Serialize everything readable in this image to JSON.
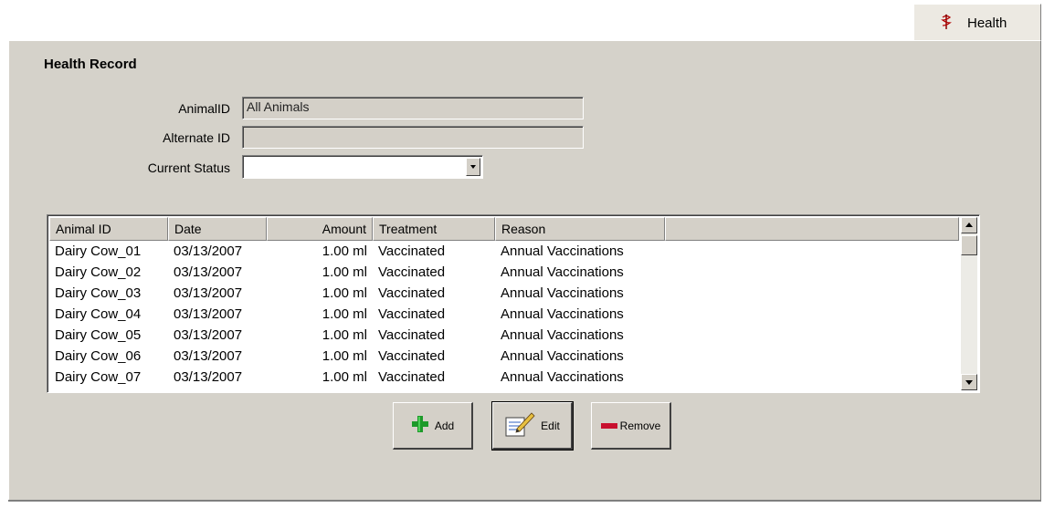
{
  "tab": {
    "label": "Health"
  },
  "section": {
    "title": "Health Record"
  },
  "form": {
    "animal_id_label": "AnimalID",
    "animal_id_value": "All Animals",
    "alternate_id_label": "Alternate ID",
    "alternate_id_value": "",
    "current_status_label": "Current Status",
    "current_status_value": ""
  },
  "grid": {
    "columns": [
      "Animal ID",
      "Date",
      "Amount",
      "Treatment",
      "Reason",
      ""
    ],
    "rows": [
      {
        "animal_id": "Dairy Cow_01",
        "date": "03/13/2007",
        "amount": "1.00 ml",
        "treatment": "Vaccinated",
        "reason": "Annual Vaccinations"
      },
      {
        "animal_id": "Dairy Cow_02",
        "date": "03/13/2007",
        "amount": "1.00 ml",
        "treatment": "Vaccinated",
        "reason": "Annual Vaccinations"
      },
      {
        "animal_id": "Dairy Cow_03",
        "date": "03/13/2007",
        "amount": "1.00 ml",
        "treatment": "Vaccinated",
        "reason": "Annual Vaccinations"
      },
      {
        "animal_id": "Dairy Cow_04",
        "date": "03/13/2007",
        "amount": "1.00 ml",
        "treatment": "Vaccinated",
        "reason": "Annual Vaccinations"
      },
      {
        "animal_id": "Dairy Cow_05",
        "date": "03/13/2007",
        "amount": "1.00 ml",
        "treatment": "Vaccinated",
        "reason": "Annual Vaccinations"
      },
      {
        "animal_id": "Dairy Cow_06",
        "date": "03/13/2007",
        "amount": "1.00 ml",
        "treatment": "Vaccinated",
        "reason": "Annual Vaccinations"
      },
      {
        "animal_id": "Dairy Cow_07",
        "date": "03/13/2007",
        "amount": "1.00 ml",
        "treatment": "Vaccinated",
        "reason": "Annual Vaccinations"
      }
    ]
  },
  "buttons": {
    "add_label": "Add",
    "edit_label": "Edit",
    "remove_label": "Remove"
  },
  "icons": {
    "tab": "health-caduceus-icon",
    "add": "green-plus-icon",
    "edit": "notepad-pencil-icon",
    "remove": "red-minus-icon"
  },
  "colors": {
    "panel_bg": "#d5d2ca",
    "add_green": "#1d9a2a",
    "remove_red": "#c8102e"
  }
}
